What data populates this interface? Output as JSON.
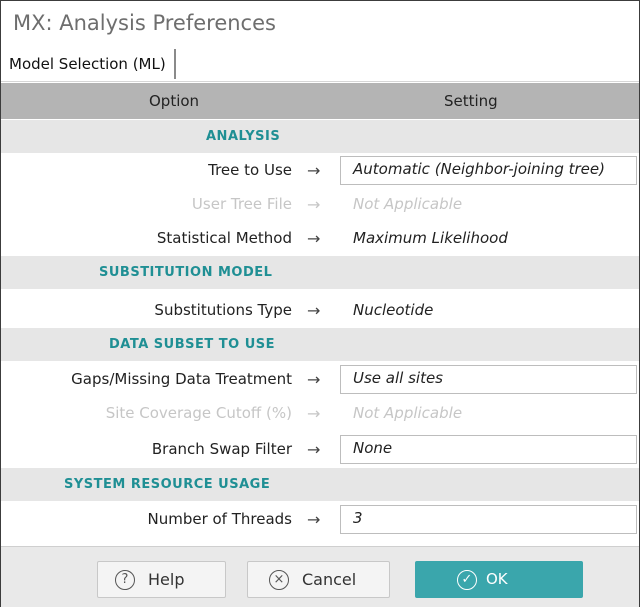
{
  "window": {
    "title": "MX: Analysis Preferences"
  },
  "tabs": [
    {
      "label": "Model Selection (ML)"
    }
  ],
  "table_header": {
    "option": "Option",
    "setting": "Setting"
  },
  "arrow_glyph": "→",
  "sections": {
    "analysis": "ANALYSIS",
    "substitution": "SUBSTITUTION MODEL",
    "data_subset": "DATA SUBSET TO USE",
    "system": "SYSTEM RESOURCE USAGE"
  },
  "rows": {
    "tree_to_use": {
      "option": "Tree to Use",
      "value": "Automatic (Neighbor-joining tree)"
    },
    "user_tree_file": {
      "option": "User Tree File",
      "value": "Not Applicable"
    },
    "statistical_method": {
      "option": "Statistical Method",
      "value": "Maximum Likelihood"
    },
    "substitutions_type": {
      "option": "Substitutions Type",
      "value": "Nucleotide"
    },
    "gaps_missing": {
      "option": "Gaps/Missing Data Treatment",
      "value": "Use all sites"
    },
    "site_coverage": {
      "option": "Site Coverage Cutoff (%)",
      "value": "Not Applicable"
    },
    "branch_swap": {
      "option": "Branch Swap Filter",
      "value": "None"
    },
    "threads": {
      "option": "Number of Threads",
      "value": "3"
    }
  },
  "buttons": {
    "help": {
      "label": "Help",
      "icon": "?"
    },
    "cancel": {
      "label": "Cancel",
      "icon": "×"
    },
    "ok": {
      "label": "OK",
      "icon": "✓"
    }
  },
  "colors": {
    "accent": "#3aa6ac",
    "section_text": "#1f8f94",
    "header_bg": "#b4b4b4",
    "section_bg": "#e6e6e6"
  }
}
